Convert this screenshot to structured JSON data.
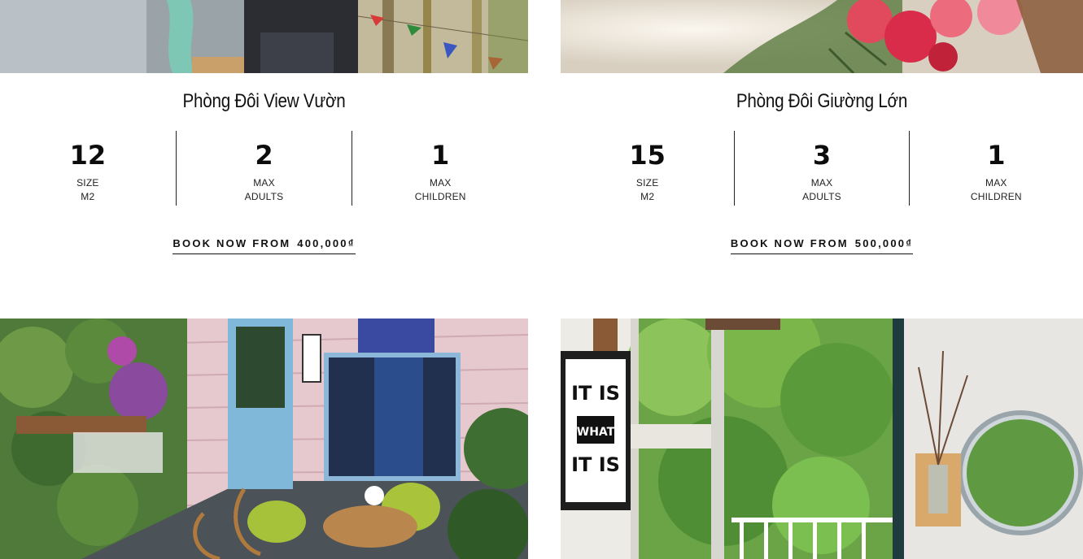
{
  "rooms": [
    {
      "title": "Phòng Đôi View Vườn",
      "stats": [
        {
          "value": "12",
          "label_line1": "SIZE",
          "label_line2": "M2"
        },
        {
          "value": "2",
          "label_line1": "MAX",
          "label_line2": "ADULTS"
        },
        {
          "value": "1",
          "label_line1": "MAX",
          "label_line2": "CHILDREN"
        }
      ],
      "book_label": "BOOK NOW FROM",
      "price": "400,000₫"
    },
    {
      "title": "Phòng Đôi Giường Lớn",
      "stats": [
        {
          "value": "15",
          "label_line1": "SIZE",
          "label_line2": "M2"
        },
        {
          "value": "3",
          "label_line1": "MAX",
          "label_line2": "ADULTS"
        },
        {
          "value": "1",
          "label_line1": "MAX",
          "label_line2": "CHILDREN"
        }
      ],
      "book_label": "BOOK NOW FROM",
      "price": "500,000₫"
    }
  ],
  "posters": {
    "sign_text": "IT IS WHAT IT IS"
  }
}
